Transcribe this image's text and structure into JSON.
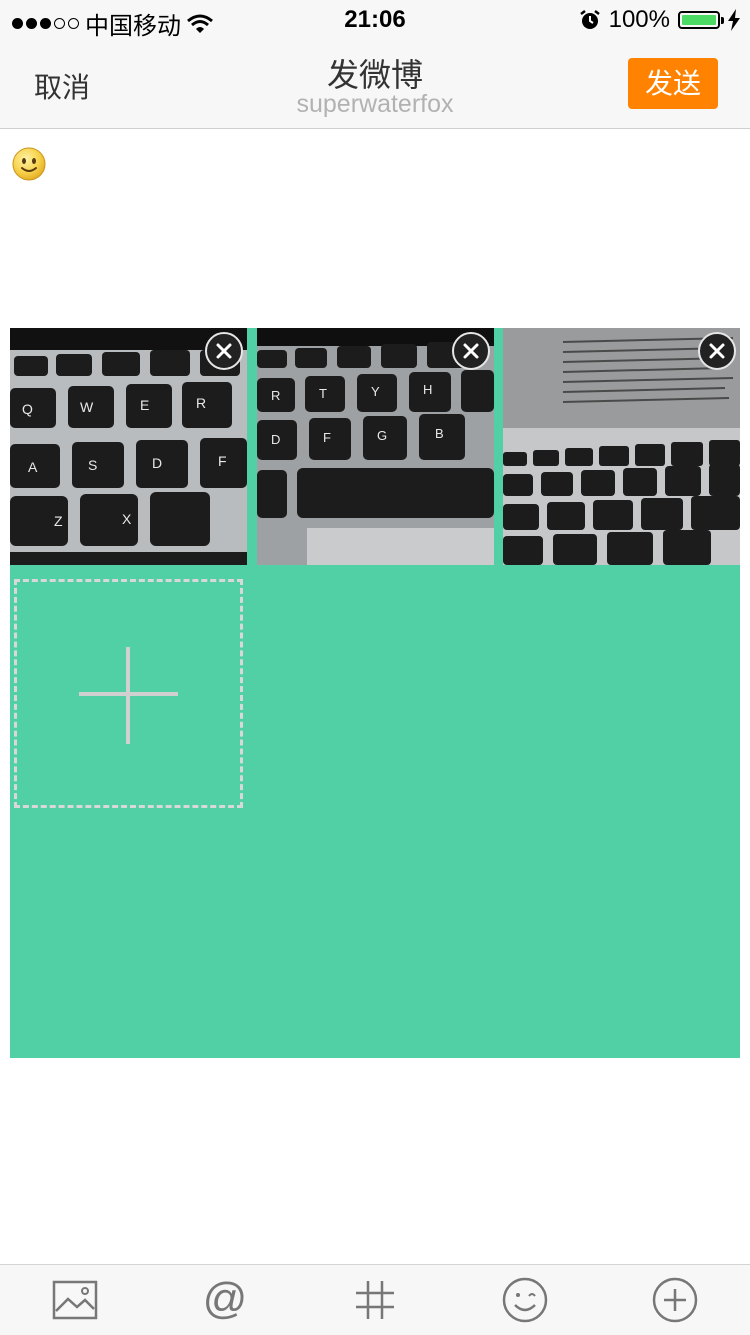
{
  "status_bar": {
    "carrier": "中国移动",
    "signal_strength": 3,
    "signal_max": 5,
    "time": "21:06",
    "battery": "100%",
    "battery_level": 1.0
  },
  "nav": {
    "cancel_label": "取消",
    "title": "发微博",
    "subtitle": "superwaterfox",
    "send_label": "发送"
  },
  "compose": {
    "text": "",
    "emoji_icon": "smiley-emoji",
    "photos": [
      {
        "icon": "keyboard-photo",
        "remove_icon": "close-icon"
      },
      {
        "icon": "keyboard-photo",
        "remove_icon": "close-icon"
      },
      {
        "icon": "keyboard-photo",
        "remove_icon": "close-icon"
      }
    ],
    "add_photo_icon": "plus-icon"
  },
  "toolbar": {
    "items": [
      {
        "icon": "image-icon"
      },
      {
        "icon": "at-icon"
      },
      {
        "icon": "hashtag-icon"
      },
      {
        "icon": "emoji-icon"
      },
      {
        "icon": "add-circle-icon"
      }
    ]
  },
  "colors": {
    "accent": "#ff8200",
    "photo_area": "#50d0a4",
    "bar_bg": "#f7f7f7",
    "subtitle": "#b2b2b2",
    "battery": "#4cd964"
  }
}
